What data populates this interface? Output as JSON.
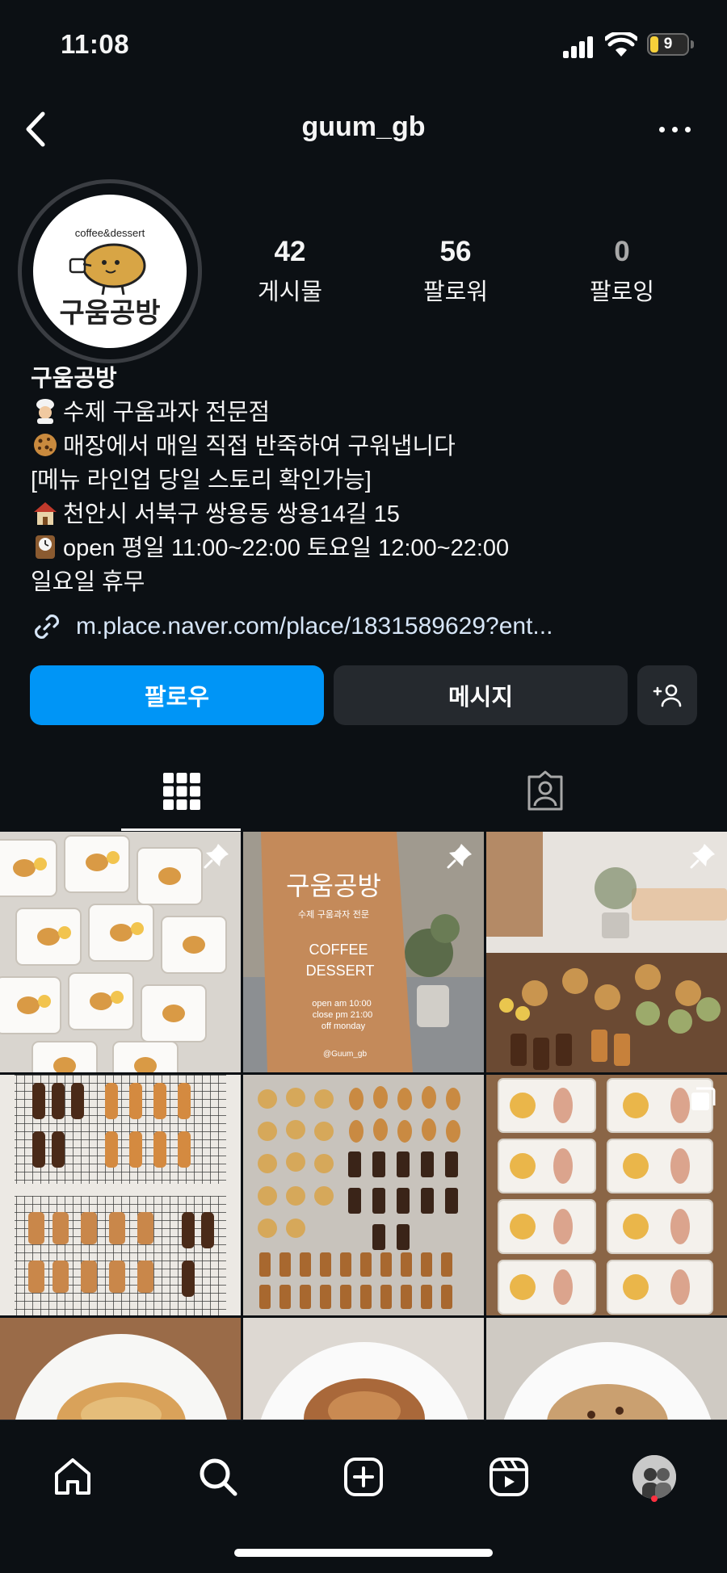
{
  "status_bar": {
    "time": "11:08",
    "battery": "9"
  },
  "header": {
    "username": "guum_gb"
  },
  "profile": {
    "avatar_logo_text": "구움공방",
    "avatar_logo_subtext": "coffee&dessert",
    "stats": [
      {
        "count": "42",
        "label": "게시물"
      },
      {
        "count": "56",
        "label": "팔로워"
      },
      {
        "count": "0",
        "label": "팔로잉"
      }
    ],
    "name": "구움공방",
    "bio_lines": [
      {
        "icon": "chef-emoji",
        "text": "수제 구움과자 전문점"
      },
      {
        "icon": "cookie-emoji",
        "text": "매장에서 매일 직접 반죽하여 구워냅니다"
      },
      {
        "icon": "",
        "text": "[메뉴 라인업 당일 스토리 확인가능]"
      },
      {
        "icon": "house-emoji",
        "text": "천안시 서북구 쌍용동 쌍용14길 15"
      },
      {
        "icon": "clock-emoji",
        "text": "open 평일 11:00~22:00 토요일 12:00~22:00"
      },
      {
        "icon": "",
        "text": "일요일 휴무"
      }
    ],
    "link": "m.place.naver.com/place/1831589629?ent..."
  },
  "actions": {
    "follow": "팔로우",
    "message": "메시지"
  },
  "posts": [
    {
      "type": "pinned",
      "subject": "boxed madeleines and egg tarts"
    },
    {
      "type": "pinned",
      "subject": "store sign board",
      "sign": {
        "title": "구움공방",
        "subtitle": "수제 구움과자 전문",
        "line1": "COFFEE",
        "line2": "DESSERT",
        "hours1": "open am 10:00",
        "hours2": "close pm 21:00",
        "hours3": "off monday",
        "handle": "@Guum_gb"
      }
    },
    {
      "type": "pinned",
      "subject": "dessert table display"
    },
    {
      "type": "post",
      "subject": "cooling rack of baked goods"
    },
    {
      "type": "post",
      "subject": "packaged cookies and financiers"
    },
    {
      "type": "carousel",
      "subject": "boxed egg tarts and madeleines"
    },
    {
      "type": "post",
      "subject": "cookie on plate"
    },
    {
      "type": "post",
      "subject": "cookie on plate"
    },
    {
      "type": "post",
      "subject": "cookie on plate"
    }
  ],
  "colors": {
    "background": "#0c1014",
    "accent": "#0095f6",
    "button": "#25292e",
    "link": "#d6e5f7"
  }
}
